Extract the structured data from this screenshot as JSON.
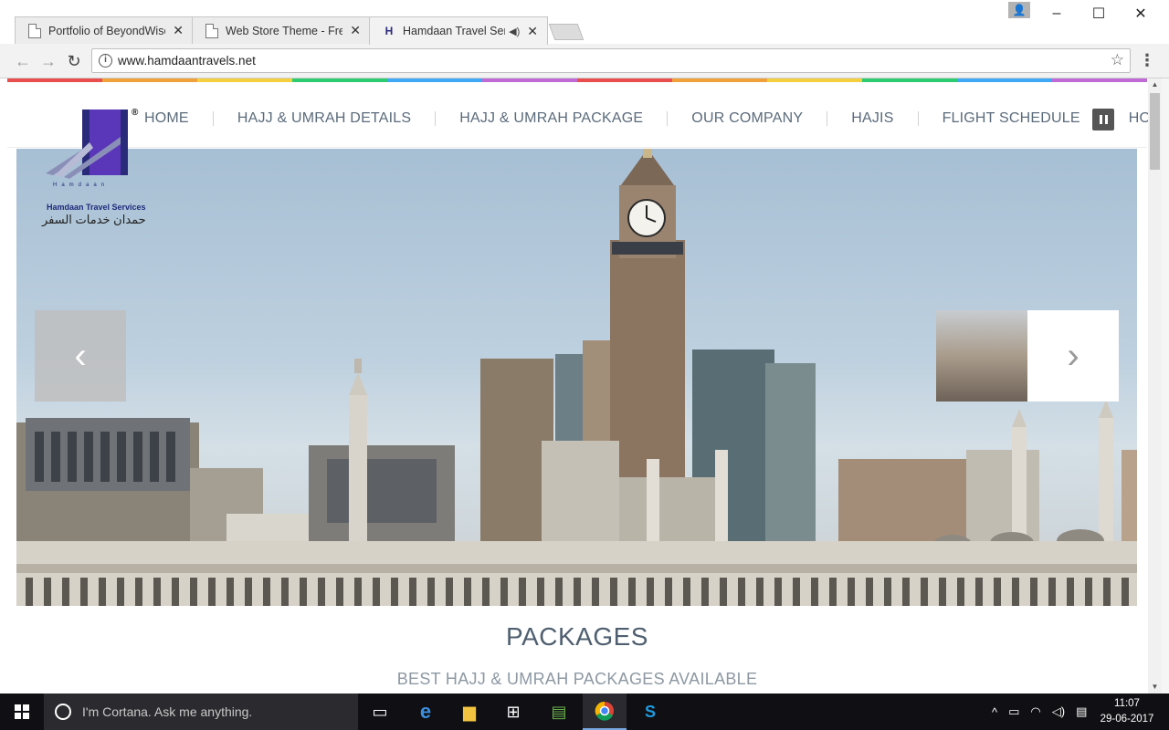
{
  "browser": {
    "tabs": [
      {
        "title": "Portfolio of BeyondWise",
        "icon": "document-icon",
        "active": false
      },
      {
        "title": "Web Store Theme - Free",
        "icon": "document-icon",
        "active": false
      },
      {
        "title": "Hamdaan Travel Servic",
        "icon": "hamdaan-favicon",
        "active": true,
        "audio": true
      }
    ],
    "url": "www.hamdaantravels.net",
    "window_controls": {
      "minimize": "–",
      "maximize": "☐",
      "close": "✕"
    }
  },
  "site": {
    "logo": {
      "letter": "H",
      "subtitle": "Hamdaan",
      "name_en": "Hamdaan Travel Services",
      "name_ar": "حمدان خدمات السفر",
      "registered": "®"
    },
    "nav": [
      {
        "label": "HOME"
      },
      {
        "label": "HAJJ & UMRAH DETAILS"
      },
      {
        "label": "HAJJ & UMRAH PACKAGE"
      },
      {
        "label": "OUR COMPANY"
      },
      {
        "label": "HAJIS"
      },
      {
        "label": "FLIGHT SCHEDULE"
      },
      {
        "label": "HOTEL"
      }
    ],
    "rainbow_colors": [
      "#e94e4e",
      "#f0a13b",
      "#f4d03f",
      "#2ecc71",
      "#3fa9f5",
      "#c06ad6",
      "#e94e4e",
      "#f0a13b",
      "#f4d03f",
      "#2ecc71",
      "#3fa9f5",
      "#c06ad6"
    ],
    "slider": {
      "prev": "‹",
      "next": "›"
    },
    "packages": {
      "title": "PACKAGES",
      "subtitle": "BEST HAJJ & UMRAH PACKAGES AVAILABLE"
    }
  },
  "taskbar": {
    "search_placeholder": "I'm Cortana. Ask me anything.",
    "time": "11:07",
    "date": "29-06-2017"
  }
}
